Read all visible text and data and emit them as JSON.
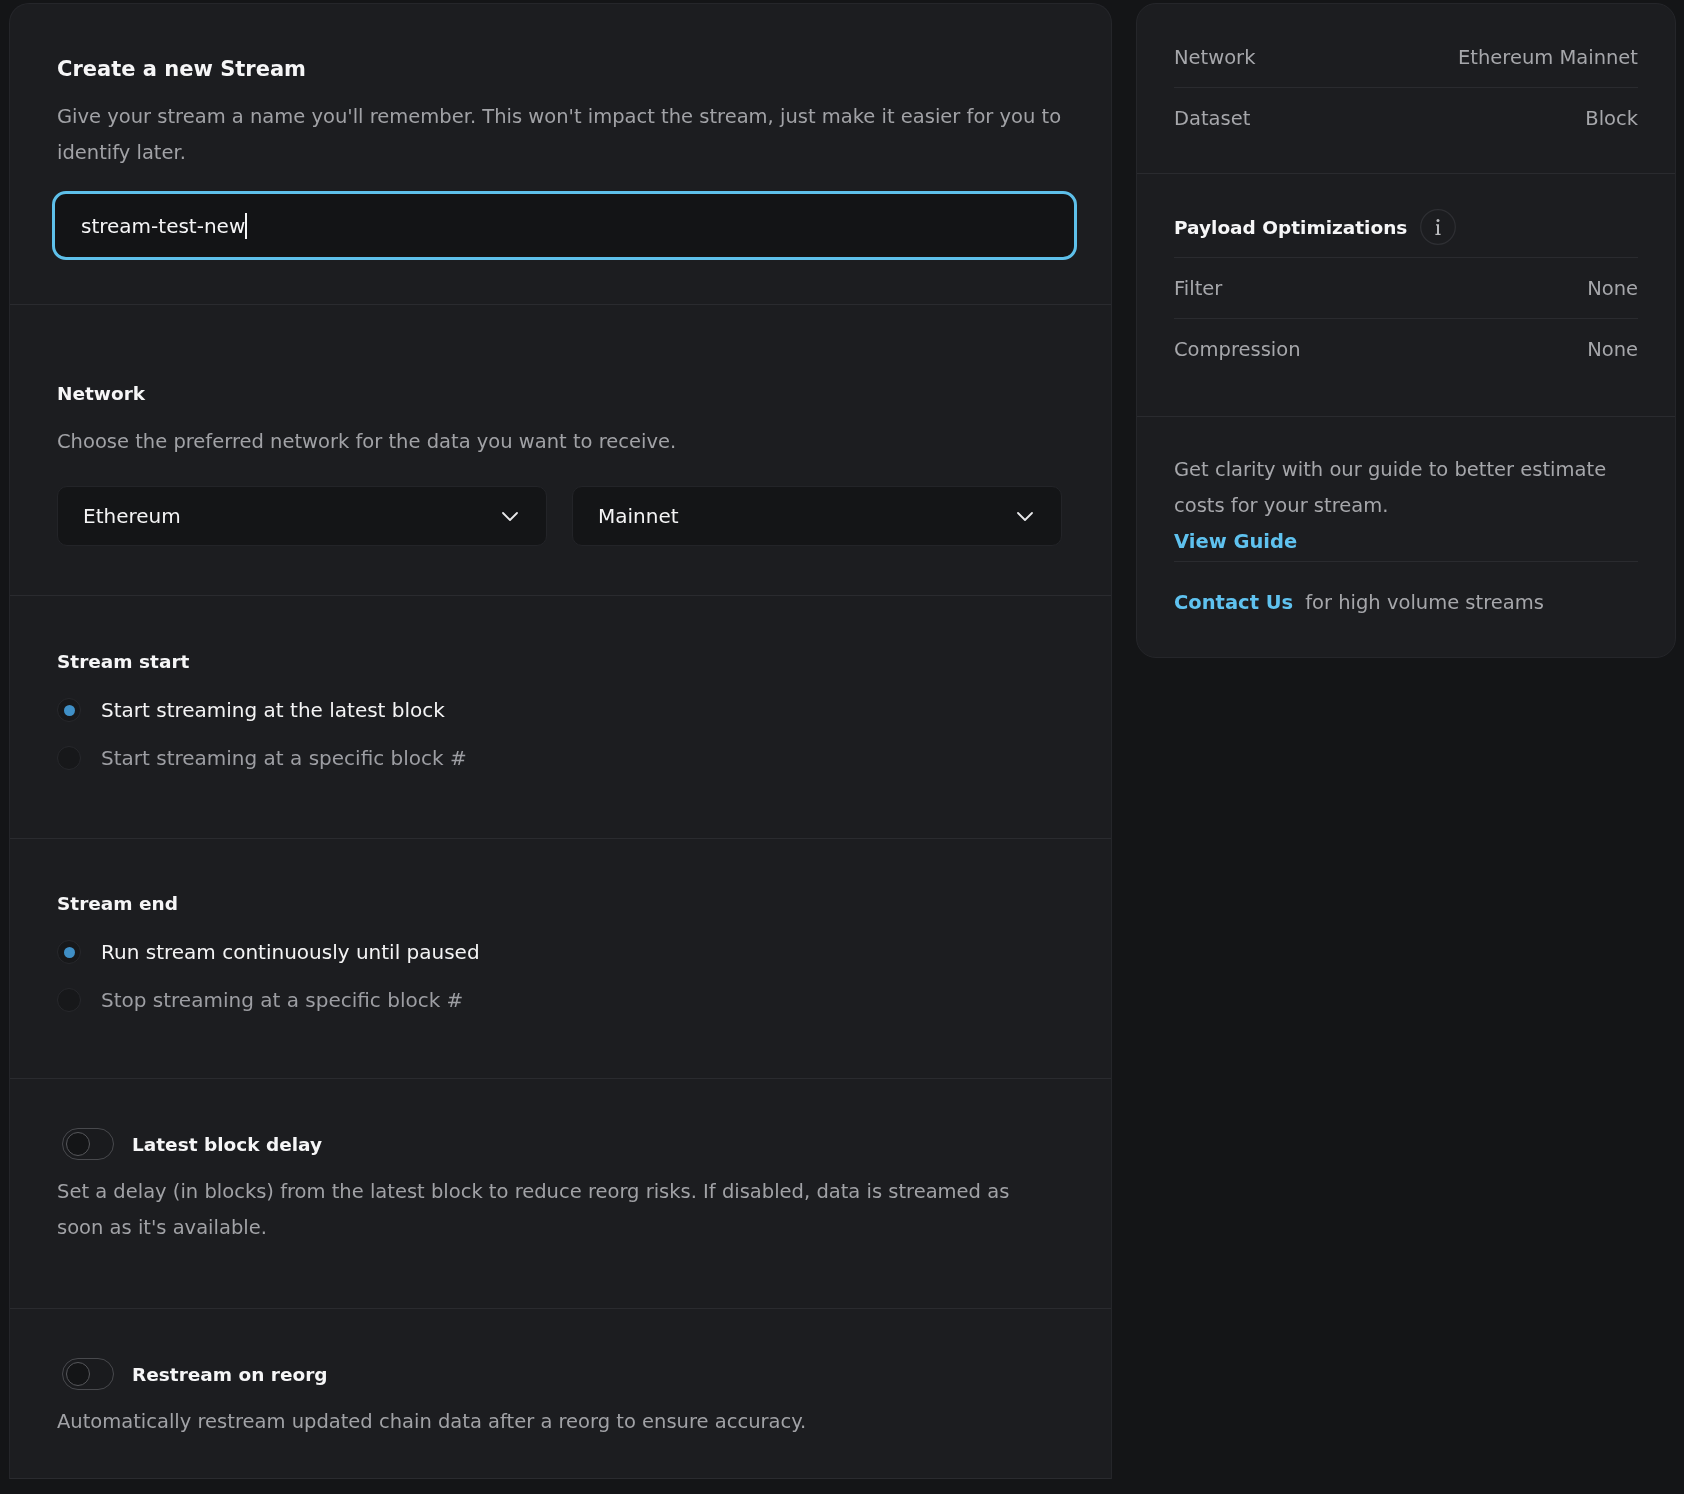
{
  "create_stream": {
    "title": "Create a new Stream",
    "description": "Give your stream a name you'll remember. This won't impact the stream, just make it easier for you to identify later.",
    "name_field": {
      "value": "stream-test-new",
      "focused": true
    }
  },
  "network": {
    "title": "Network",
    "description": "Choose the preferred network for the data you want to receive.",
    "selects": [
      {
        "value": "Ethereum"
      },
      {
        "value": "Mainnet"
      }
    ]
  },
  "stream_start": {
    "title": "Stream start",
    "options": [
      {
        "label": "Start streaming at the latest block",
        "selected": true
      },
      {
        "label": "Start streaming at a specific block #",
        "selected": false
      }
    ]
  },
  "stream_end": {
    "title": "Stream end",
    "options": [
      {
        "label": "Run stream continuously until paused",
        "selected": true
      },
      {
        "label": "Stop streaming at a specific block #",
        "selected": false
      }
    ]
  },
  "toggles": [
    {
      "label": "Latest block delay",
      "on": false,
      "description": "Set a delay (in blocks) from the latest block to reduce reorg risks. If disabled, data is streamed as soon as it's available."
    },
    {
      "label": "Restream on reorg",
      "on": false,
      "description": "Automatically restream updated chain data after a reorg to ensure accuracy."
    }
  ],
  "summary": {
    "rows": [
      {
        "label": "Network",
        "value": "Ethereum Mainnet"
      },
      {
        "label": "Dataset",
        "value": "Block"
      }
    ],
    "payload": {
      "title": "Payload Optimizations",
      "rows": [
        {
          "label": "Filter",
          "value": "None"
        },
        {
          "label": "Compression",
          "value": "None"
        }
      ]
    },
    "guide": {
      "text": "Get clarity with our guide to better estimate costs for your stream.",
      "link": "View Guide"
    },
    "contact": {
      "link": "Contact Us",
      "text": "for high volume streams"
    }
  }
}
